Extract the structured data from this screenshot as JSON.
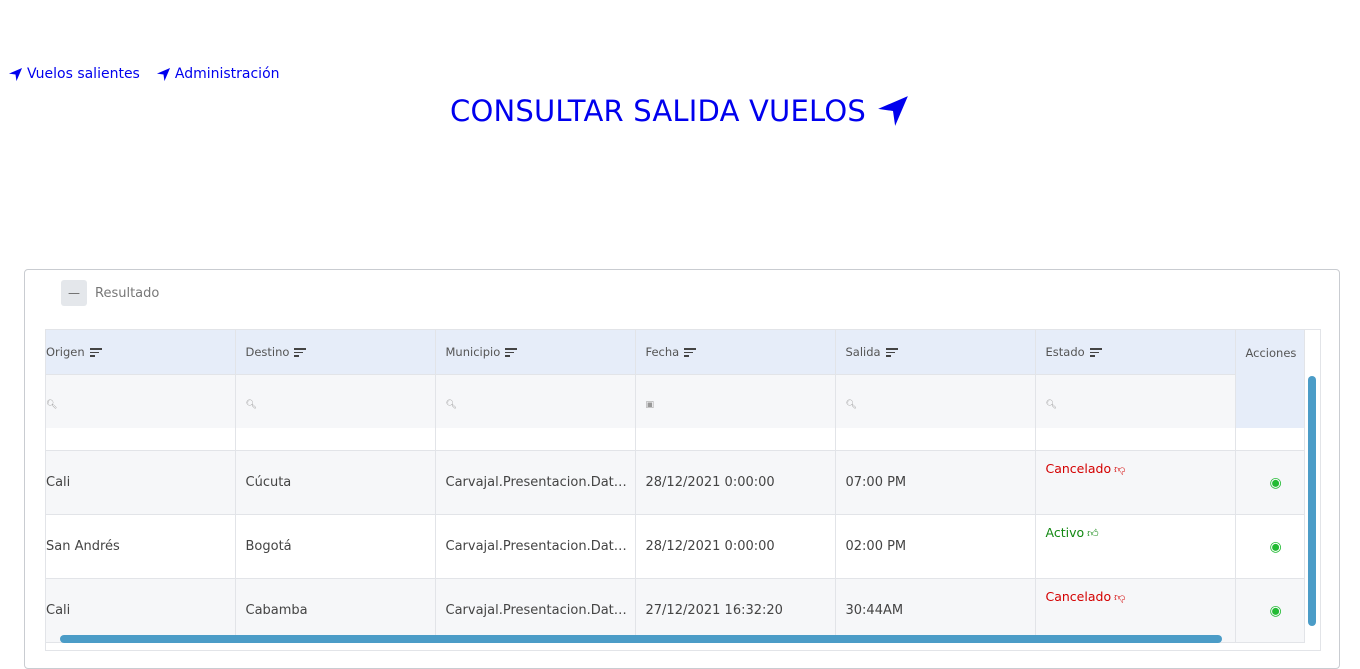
{
  "nav": {
    "links": [
      {
        "label": "Vuelos salientes",
        "icon": "location-arrow-icon"
      },
      {
        "label": "Administración",
        "icon": "location-arrow-icon"
      }
    ]
  },
  "page_title": "CONSULTAR SALIDA VUELOS",
  "panel": {
    "collapse_symbol": "—",
    "title": "Resultado"
  },
  "table": {
    "columns": [
      "Origen",
      "Destino",
      "Municipio",
      "Fecha",
      "Salida",
      "Estado"
    ],
    "actions_header": "Acciones",
    "filter_icons": [
      "search-icon",
      "search-icon",
      "search-icon",
      "calendar-icon",
      "search-icon",
      "search-icon"
    ],
    "rows": [
      {
        "origen": "Cali",
        "destino": "Cúcuta",
        "municipio": "Carvajal.Presentacion.Data.Municipio",
        "fecha": "28/12/2021 0:00:00",
        "salida": "07:00 PM",
        "estado": "Cancelado",
        "estado_type": "cancel"
      },
      {
        "origen": "San Andrés",
        "destino": "Bogotá",
        "municipio": "Carvajal.Presentacion.Data.Municipio",
        "fecha": "28/12/2021 0:00:00",
        "salida": "02:00 PM",
        "estado": "Activo",
        "estado_type": "active"
      },
      {
        "origen": "Cali",
        "destino": "Cabamba",
        "municipio": "Carvajal.Presentacion.Data.Municipio",
        "fecha": "27/12/2021 16:32:20",
        "salida": "30:44AM",
        "estado": "Cancelado",
        "estado_type": "cancel"
      }
    ]
  },
  "colors": {
    "link": "#0000ee",
    "header_bg": "#e6edf9",
    "cancel": "#d40000",
    "active": "#118811",
    "eye": "#22bb33",
    "scrollbar": "#4b9cc7"
  }
}
